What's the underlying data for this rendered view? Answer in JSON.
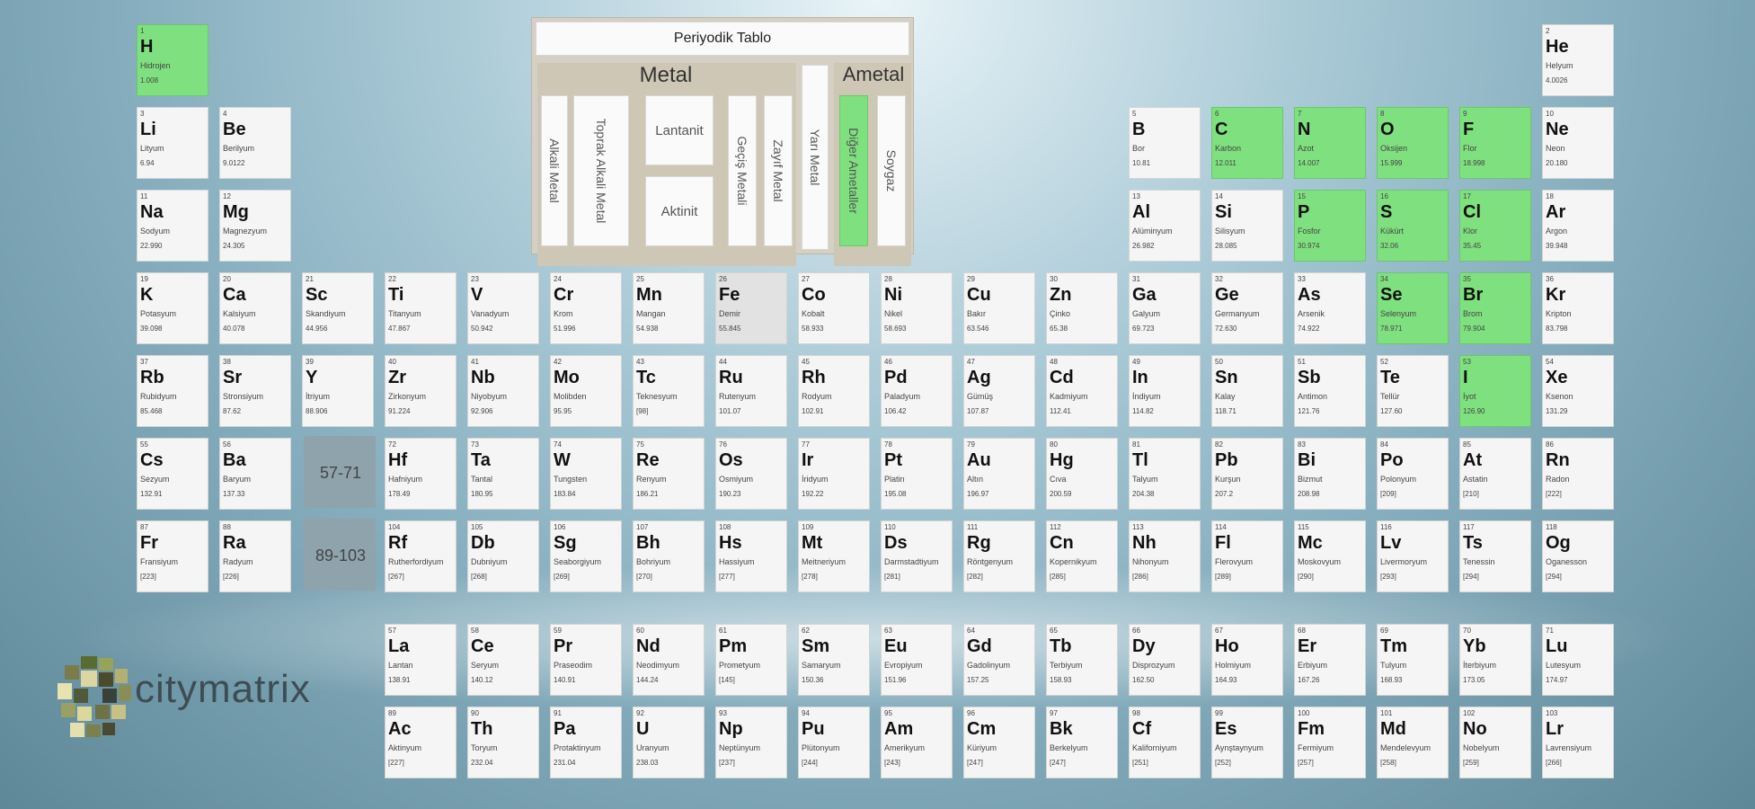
{
  "legend": {
    "title": "Periyodik Tablo",
    "metal_heading": "Metal",
    "ametal_heading": "Ametal",
    "alkali": "Alkali Metal",
    "toprak_alkali": "Toprak Alkali Metal",
    "lantanit": "Lantanit",
    "aktinit": "Aktinit",
    "gecis": "Geçiş Metali",
    "zayif": "Zayıf Metal",
    "yari": "Yarı Metal",
    "diger": "Diğer Ametaller",
    "soygaz": "Soygaz"
  },
  "ranges": {
    "lanthanide": "57-71",
    "actinide": "89-103"
  },
  "brand": {
    "name": "citymatrix"
  },
  "colors": {
    "nonmetal": "#7fe07f",
    "tile": "#f5f5f5",
    "range_tile": "#8fa3ad"
  },
  "elements": [
    {
      "n": "1",
      "s": "H",
      "name": "Hidrojen",
      "m": "1.008",
      "col": 1,
      "row": 1,
      "nm": true
    },
    {
      "n": "2",
      "s": "He",
      "name": "Helyum",
      "m": "4.0026",
      "col": 18,
      "row": 1
    },
    {
      "n": "3",
      "s": "Li",
      "name": "Lityum",
      "m": "6.94",
      "col": 1,
      "row": 2
    },
    {
      "n": "4",
      "s": "Be",
      "name": "Berilyum",
      "m": "9.0122",
      "col": 2,
      "row": 2
    },
    {
      "n": "5",
      "s": "B",
      "name": "Bor",
      "m": "10.81",
      "col": 13,
      "row": 2
    },
    {
      "n": "6",
      "s": "C",
      "name": "Karbon",
      "m": "12.011",
      "col": 14,
      "row": 2,
      "nm": true
    },
    {
      "n": "7",
      "s": "N",
      "name": "Azot",
      "m": "14.007",
      "col": 15,
      "row": 2,
      "nm": true
    },
    {
      "n": "8",
      "s": "O",
      "name": "Oksijen",
      "m": "15.999",
      "col": 16,
      "row": 2,
      "nm": true
    },
    {
      "n": "9",
      "s": "F",
      "name": "Flor",
      "m": "18.998",
      "col": 17,
      "row": 2,
      "nm": true
    },
    {
      "n": "10",
      "s": "Ne",
      "name": "Neon",
      "m": "20.180",
      "col": 18,
      "row": 2
    },
    {
      "n": "11",
      "s": "Na",
      "name": "Sodyum",
      "m": "22.990",
      "col": 1,
      "row": 3
    },
    {
      "n": "12",
      "s": "Mg",
      "name": "Magnezyum",
      "m": "24.305",
      "col": 2,
      "row": 3
    },
    {
      "n": "13",
      "s": "Al",
      "name": "Alüminyum",
      "m": "26.982",
      "col": 13,
      "row": 3
    },
    {
      "n": "14",
      "s": "Si",
      "name": "Silisyum",
      "m": "28.085",
      "col": 14,
      "row": 3
    },
    {
      "n": "15",
      "s": "P",
      "name": "Fosfor",
      "m": "30.974",
      "col": 15,
      "row": 3,
      "nm": true
    },
    {
      "n": "16",
      "s": "S",
      "name": "Kükürt",
      "m": "32.06",
      "col": 16,
      "row": 3,
      "nm": true
    },
    {
      "n": "17",
      "s": "Cl",
      "name": "Klor",
      "m": "35.45",
      "col": 17,
      "row": 3,
      "nm": true
    },
    {
      "n": "18",
      "s": "Ar",
      "name": "Argon",
      "m": "39.948",
      "col": 18,
      "row": 3
    },
    {
      "n": "19",
      "s": "K",
      "name": "Potasyum",
      "m": "39.098",
      "col": 1,
      "row": 4
    },
    {
      "n": "20",
      "s": "Ca",
      "name": "Kalsiyum",
      "m": "40.078",
      "col": 2,
      "row": 4
    },
    {
      "n": "21",
      "s": "Sc",
      "name": "Skandiyum",
      "m": "44.956",
      "col": 3,
      "row": 4
    },
    {
      "n": "22",
      "s": "Ti",
      "name": "Titanyum",
      "m": "47.867",
      "col": 4,
      "row": 4
    },
    {
      "n": "23",
      "s": "V",
      "name": "Vanadyum",
      "m": "50.942",
      "col": 5,
      "row": 4
    },
    {
      "n": "24",
      "s": "Cr",
      "name": "Krom",
      "m": "51.996",
      "col": 6,
      "row": 4
    },
    {
      "n": "25",
      "s": "Mn",
      "name": "Mangan",
      "m": "54.938",
      "col": 7,
      "row": 4
    },
    {
      "n": "26",
      "s": "Fe",
      "name": "Demir",
      "m": "55.845",
      "col": 8,
      "row": 4,
      "sel": true
    },
    {
      "n": "27",
      "s": "Co",
      "name": "Kobalt",
      "m": "58.933",
      "col": 9,
      "row": 4
    },
    {
      "n": "28",
      "s": "Ni",
      "name": "Nikel",
      "m": "58.693",
      "col": 10,
      "row": 4
    },
    {
      "n": "29",
      "s": "Cu",
      "name": "Bakır",
      "m": "63.546",
      "col": 11,
      "row": 4
    },
    {
      "n": "30",
      "s": "Zn",
      "name": "Çinko",
      "m": "65.38",
      "col": 12,
      "row": 4
    },
    {
      "n": "31",
      "s": "Ga",
      "name": "Galyum",
      "m": "69.723",
      "col": 13,
      "row": 4
    },
    {
      "n": "32",
      "s": "Ge",
      "name": "Germanyum",
      "m": "72.630",
      "col": 14,
      "row": 4
    },
    {
      "n": "33",
      "s": "As",
      "name": "Arsenik",
      "m": "74.922",
      "col": 15,
      "row": 4
    },
    {
      "n": "34",
      "s": "Se",
      "name": "Selenyum",
      "m": "78.971",
      "col": 16,
      "row": 4,
      "nm": true
    },
    {
      "n": "35",
      "s": "Br",
      "name": "Brom",
      "m": "79.904",
      "col": 17,
      "row": 4,
      "nm": true
    },
    {
      "n": "36",
      "s": "Kr",
      "name": "Kripton",
      "m": "83.798",
      "col": 18,
      "row": 4
    },
    {
      "n": "37",
      "s": "Rb",
      "name": "Rubidyum",
      "m": "85.468",
      "col": 1,
      "row": 5
    },
    {
      "n": "38",
      "s": "Sr",
      "name": "Stronsiyum",
      "m": "87.62",
      "col": 2,
      "row": 5
    },
    {
      "n": "39",
      "s": "Y",
      "name": "İtriyum",
      "m": "88.906",
      "col": 3,
      "row": 5
    },
    {
      "n": "40",
      "s": "Zr",
      "name": "Zirkonyum",
      "m": "91.224",
      "col": 4,
      "row": 5
    },
    {
      "n": "41",
      "s": "Nb",
      "name": "Niyobyum",
      "m": "92.906",
      "col": 5,
      "row": 5
    },
    {
      "n": "42",
      "s": "Mo",
      "name": "Molibden",
      "m": "95.95",
      "col": 6,
      "row": 5
    },
    {
      "n": "43",
      "s": "Tc",
      "name": "Teknesyum",
      "m": "[98]",
      "col": 7,
      "row": 5
    },
    {
      "n": "44",
      "s": "Ru",
      "name": "Rutenyum",
      "m": "101.07",
      "col": 8,
      "row": 5
    },
    {
      "n": "45",
      "s": "Rh",
      "name": "Rodyum",
      "m": "102.91",
      "col": 9,
      "row": 5
    },
    {
      "n": "46",
      "s": "Pd",
      "name": "Paladyum",
      "m": "106.42",
      "col": 10,
      "row": 5
    },
    {
      "n": "47",
      "s": "Ag",
      "name": "Gümüş",
      "m": "107.87",
      "col": 11,
      "row": 5
    },
    {
      "n": "48",
      "s": "Cd",
      "name": "Kadmiyum",
      "m": "112.41",
      "col": 12,
      "row": 5
    },
    {
      "n": "49",
      "s": "In",
      "name": "İndiyum",
      "m": "114.82",
      "col": 13,
      "row": 5
    },
    {
      "n": "50",
      "s": "Sn",
      "name": "Kalay",
      "m": "118.71",
      "col": 14,
      "row": 5
    },
    {
      "n": "51",
      "s": "Sb",
      "name": "Antimon",
      "m": "121.76",
      "col": 15,
      "row": 5
    },
    {
      "n": "52",
      "s": "Te",
      "name": "Tellür",
      "m": "127.60",
      "col": 16,
      "row": 5
    },
    {
      "n": "53",
      "s": "I",
      "name": "İyot",
      "m": "126.90",
      "col": 17,
      "row": 5,
      "nm": true
    },
    {
      "n": "54",
      "s": "Xe",
      "name": "Ksenon",
      "m": "131.29",
      "col": 18,
      "row": 5
    },
    {
      "n": "55",
      "s": "Cs",
      "name": "Sezyum",
      "m": "132.91",
      "col": 1,
      "row": 6
    },
    {
      "n": "56",
      "s": "Ba",
      "name": "Baryum",
      "m": "137.33",
      "col": 2,
      "row": 6
    },
    {
      "n": "72",
      "s": "Hf",
      "name": "Hafniyum",
      "m": "178.49",
      "col": 4,
      "row": 6
    },
    {
      "n": "73",
      "s": "Ta",
      "name": "Tantal",
      "m": "180.95",
      "col": 5,
      "row": 6
    },
    {
      "n": "74",
      "s": "W",
      "name": "Tungsten",
      "m": "183.84",
      "col": 6,
      "row": 6
    },
    {
      "n": "75",
      "s": "Re",
      "name": "Renyum",
      "m": "186.21",
      "col": 7,
      "row": 6
    },
    {
      "n": "76",
      "s": "Os",
      "name": "Osmiyum",
      "m": "190.23",
      "col": 8,
      "row": 6
    },
    {
      "n": "77",
      "s": "Ir",
      "name": "İridyum",
      "m": "192.22",
      "col": 9,
      "row": 6
    },
    {
      "n": "78",
      "s": "Pt",
      "name": "Platin",
      "m": "195.08",
      "col": 10,
      "row": 6
    },
    {
      "n": "79",
      "s": "Au",
      "name": "Altın",
      "m": "196.97",
      "col": 11,
      "row": 6
    },
    {
      "n": "80",
      "s": "Hg",
      "name": "Cıva",
      "m": "200.59",
      "col": 12,
      "row": 6
    },
    {
      "n": "81",
      "s": "Tl",
      "name": "Talyum",
      "m": "204.38",
      "col": 13,
      "row": 6
    },
    {
      "n": "82",
      "s": "Pb",
      "name": "Kurşun",
      "m": "207.2",
      "col": 14,
      "row": 6
    },
    {
      "n": "83",
      "s": "Bi",
      "name": "Bizmut",
      "m": "208.98",
      "col": 15,
      "row": 6
    },
    {
      "n": "84",
      "s": "Po",
      "name": "Polonyum",
      "m": "[209]",
      "col": 16,
      "row": 6
    },
    {
      "n": "85",
      "s": "At",
      "name": "Astatin",
      "m": "[210]",
      "col": 17,
      "row": 6
    },
    {
      "n": "86",
      "s": "Rn",
      "name": "Radon",
      "m": "[222]",
      "col": 18,
      "row": 6
    },
    {
      "n": "87",
      "s": "Fr",
      "name": "Fransiyum",
      "m": "[223]",
      "col": 1,
      "row": 7
    },
    {
      "n": "88",
      "s": "Ra",
      "name": "Radyum",
      "m": "[226]",
      "col": 2,
      "row": 7
    },
    {
      "n": "104",
      "s": "Rf",
      "name": "Rutherfordiyum",
      "m": "[267]",
      "col": 4,
      "row": 7
    },
    {
      "n": "105",
      "s": "Db",
      "name": "Dubniyum",
      "m": "[268]",
      "col": 5,
      "row": 7
    },
    {
      "n": "106",
      "s": "Sg",
      "name": "Seaborgiyum",
      "m": "[269]",
      "col": 6,
      "row": 7
    },
    {
      "n": "107",
      "s": "Bh",
      "name": "Bohriyum",
      "m": "[270]",
      "col": 7,
      "row": 7
    },
    {
      "n": "108",
      "s": "Hs",
      "name": "Hassiyum",
      "m": "[277]",
      "col": 8,
      "row": 7
    },
    {
      "n": "109",
      "s": "Mt",
      "name": "Meitneriyum",
      "m": "[278]",
      "col": 9,
      "row": 7
    },
    {
      "n": "110",
      "s": "Ds",
      "name": "Darmstadtiyum",
      "m": "[281]",
      "col": 10,
      "row": 7
    },
    {
      "n": "111",
      "s": "Rg",
      "name": "Röntgenyum",
      "m": "[282]",
      "col": 11,
      "row": 7
    },
    {
      "n": "112",
      "s": "Cn",
      "name": "Kopernikyum",
      "m": "[285]",
      "col": 12,
      "row": 7
    },
    {
      "n": "113",
      "s": "Nh",
      "name": "Nihonyum",
      "m": "[286]",
      "col": 13,
      "row": 7
    },
    {
      "n": "114",
      "s": "Fl",
      "name": "Flerovyum",
      "m": "[289]",
      "col": 14,
      "row": 7
    },
    {
      "n": "115",
      "s": "Mc",
      "name": "Moskovyum",
      "m": "[290]",
      "col": 15,
      "row": 7
    },
    {
      "n": "116",
      "s": "Lv",
      "name": "Livermoryum",
      "m": "[293]",
      "col": 16,
      "row": 7
    },
    {
      "n": "117",
      "s": "Ts",
      "name": "Tenessin",
      "m": "[294]",
      "col": 17,
      "row": 7
    },
    {
      "n": "118",
      "s": "Og",
      "name": "Oganesson",
      "m": "[294]",
      "col": 18,
      "row": 7
    },
    {
      "n": "57",
      "s": "La",
      "name": "Lantan",
      "m": "138.91",
      "col": 4,
      "row": 8
    },
    {
      "n": "58",
      "s": "Ce",
      "name": "Seryum",
      "m": "140.12",
      "col": 5,
      "row": 8
    },
    {
      "n": "59",
      "s": "Pr",
      "name": "Praseodim",
      "m": "140.91",
      "col": 6,
      "row": 8
    },
    {
      "n": "60",
      "s": "Nd",
      "name": "Neodimyum",
      "m": "144.24",
      "col": 7,
      "row": 8
    },
    {
      "n": "61",
      "s": "Pm",
      "name": "Prometyum",
      "m": "[145]",
      "col": 8,
      "row": 8
    },
    {
      "n": "62",
      "s": "Sm",
      "name": "Samaryum",
      "m": "150.36",
      "col": 9,
      "row": 8
    },
    {
      "n": "63",
      "s": "Eu",
      "name": "Evropiyum",
      "m": "151.96",
      "col": 10,
      "row": 8
    },
    {
      "n": "64",
      "s": "Gd",
      "name": "Gadolinyum",
      "m": "157.25",
      "col": 11,
      "row": 8
    },
    {
      "n": "65",
      "s": "Tb",
      "name": "Terbiyum",
      "m": "158.93",
      "col": 12,
      "row": 8
    },
    {
      "n": "66",
      "s": "Dy",
      "name": "Disprozyum",
      "m": "162.50",
      "col": 13,
      "row": 8
    },
    {
      "n": "67",
      "s": "Ho",
      "name": "Holmiyum",
      "m": "164.93",
      "col": 14,
      "row": 8
    },
    {
      "n": "68",
      "s": "Er",
      "name": "Erbiyum",
      "m": "167.26",
      "col": 15,
      "row": 8
    },
    {
      "n": "69",
      "s": "Tm",
      "name": "Tulyum",
      "m": "168.93",
      "col": 16,
      "row": 8
    },
    {
      "n": "70",
      "s": "Yb",
      "name": "İterbiyum",
      "m": "173.05",
      "col": 17,
      "row": 8
    },
    {
      "n": "71",
      "s": "Lu",
      "name": "Lutesyum",
      "m": "174.97",
      "col": 18,
      "row": 8
    },
    {
      "n": "89",
      "s": "Ac",
      "name": "Aktinyum",
      "m": "[227]",
      "col": 4,
      "row": 9
    },
    {
      "n": "90",
      "s": "Th",
      "name": "Toryum",
      "m": "232.04",
      "col": 5,
      "row": 9
    },
    {
      "n": "91",
      "s": "Pa",
      "name": "Protaktinyum",
      "m": "231.04",
      "col": 6,
      "row": 9
    },
    {
      "n": "92",
      "s": "U",
      "name": "Uranyum",
      "m": "238.03",
      "col": 7,
      "row": 9
    },
    {
      "n": "93",
      "s": "Np",
      "name": "Neptünyum",
      "m": "[237]",
      "col": 8,
      "row": 9
    },
    {
      "n": "94",
      "s": "Pu",
      "name": "Plütonyum",
      "m": "[244]",
      "col": 9,
      "row": 9
    },
    {
      "n": "95",
      "s": "Am",
      "name": "Amerikyum",
      "m": "[243]",
      "col": 10,
      "row": 9
    },
    {
      "n": "96",
      "s": "Cm",
      "name": "Küriyum",
      "m": "[247]",
      "col": 11,
      "row": 9
    },
    {
      "n": "97",
      "s": "Bk",
      "name": "Berkelyum",
      "m": "[247]",
      "col": 12,
      "row": 9
    },
    {
      "n": "98",
      "s": "Cf",
      "name": "Kaliforniyum",
      "m": "[251]",
      "col": 13,
      "row": 9
    },
    {
      "n": "99",
      "s": "Es",
      "name": "Aynştaynyum",
      "m": "[252]",
      "col": 14,
      "row": 9
    },
    {
      "n": "100",
      "s": "Fm",
      "name": "Fermiyum",
      "m": "[257]",
      "col": 15,
      "row": 9
    },
    {
      "n": "101",
      "s": "Md",
      "name": "Mendelevyum",
      "m": "[258]",
      "col": 16,
      "row": 9
    },
    {
      "n": "102",
      "s": "No",
      "name": "Nobelyum",
      "m": "[259]",
      "col": 17,
      "row": 9
    },
    {
      "n": "103",
      "s": "Lr",
      "name": "Lavrensiyum",
      "m": "[266]",
      "col": 18,
      "row": 9
    }
  ]
}
